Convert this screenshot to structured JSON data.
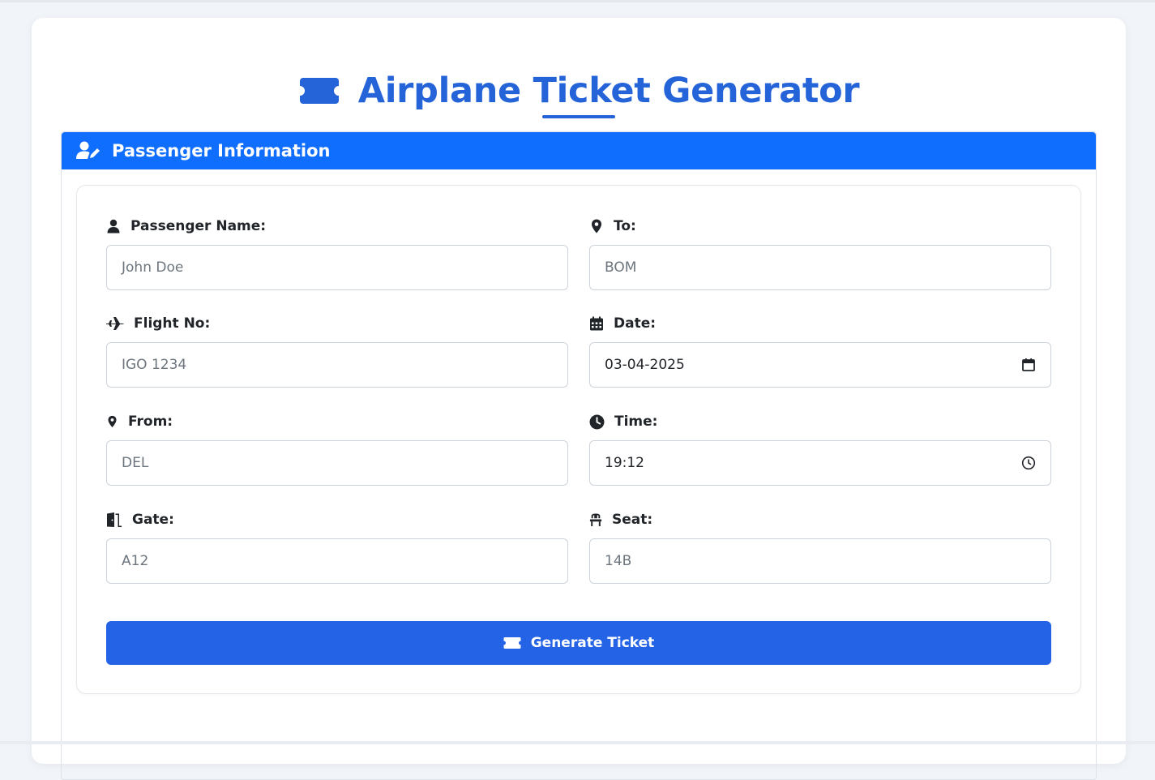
{
  "header": {
    "title": "Airplane Ticket Generator",
    "icon": "ticket-icon"
  },
  "panel": {
    "title": "Passenger Information",
    "icon": "user-edit-icon"
  },
  "fields": {
    "passenger_name": {
      "label": "Passenger Name:",
      "placeholder": "John Doe",
      "icon": "user-icon"
    },
    "to": {
      "label": "To:",
      "placeholder": "BOM",
      "icon": "map-pin-icon"
    },
    "flight_no": {
      "label": "Flight No:",
      "placeholder": "IGO 1234",
      "icon": "plane-icon"
    },
    "date": {
      "label": "Date:",
      "value": "03-04-2025",
      "icon": "calendar-icon"
    },
    "from": {
      "label": "From:",
      "placeholder": "DEL",
      "icon": "map-pin-icon"
    },
    "time": {
      "label": "Time:",
      "value": "19:12",
      "icon": "clock-icon"
    },
    "gate": {
      "label": "Gate:",
      "placeholder": "A12",
      "icon": "door-icon"
    },
    "seat": {
      "label": "Seat:",
      "placeholder": "14B",
      "icon": "chair-icon"
    }
  },
  "actions": {
    "generate_label": "Generate Ticket"
  },
  "colors": {
    "accent": "#2563d8",
    "header_bg": "#0f6efd",
    "button_bg": "#2563e6"
  }
}
